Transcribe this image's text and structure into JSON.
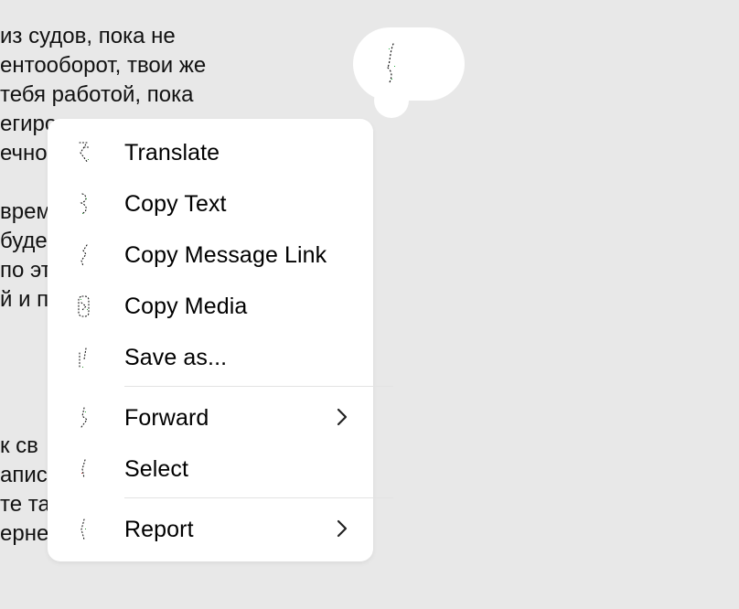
{
  "background_chat": {
    "lines": [
      "из судов, пока не",
      "ентооборот, твои же",
      "тебя работой, пока",
      "егиро",
      "ечнос",
      "",
      "врем",
      "буде",
      "по эт",
      "й и п",
      "",
      "",
      "",
      "к св",
      "апис",
      "те та",
      "ерне"
    ]
  },
  "context_menu": {
    "items": [
      {
        "label": "Translate",
        "icon": "translate-icon",
        "has_submenu": false
      },
      {
        "label": "Copy Text",
        "icon": "copy-text-icon",
        "has_submenu": false
      },
      {
        "label": "Copy Message Link",
        "icon": "link-icon",
        "has_submenu": false
      },
      {
        "label": "Copy Media",
        "icon": "copy-media-icon",
        "has_submenu": false
      },
      {
        "label": "Save as...",
        "icon": "save-icon",
        "has_submenu": false
      },
      {
        "label": "Forward",
        "icon": "forward-icon",
        "has_submenu": true
      },
      {
        "label": "Select",
        "icon": "select-icon",
        "has_submenu": false
      },
      {
        "label": "Report",
        "icon": "report-icon",
        "has_submenu": true
      }
    ]
  },
  "reaction_bubble": {
    "icon": "reaction-icon"
  },
  "colors": {
    "background": "#e8e8e8",
    "menu_background": "#ffffff",
    "text": "#000000",
    "divider": "#e3e3e3"
  }
}
